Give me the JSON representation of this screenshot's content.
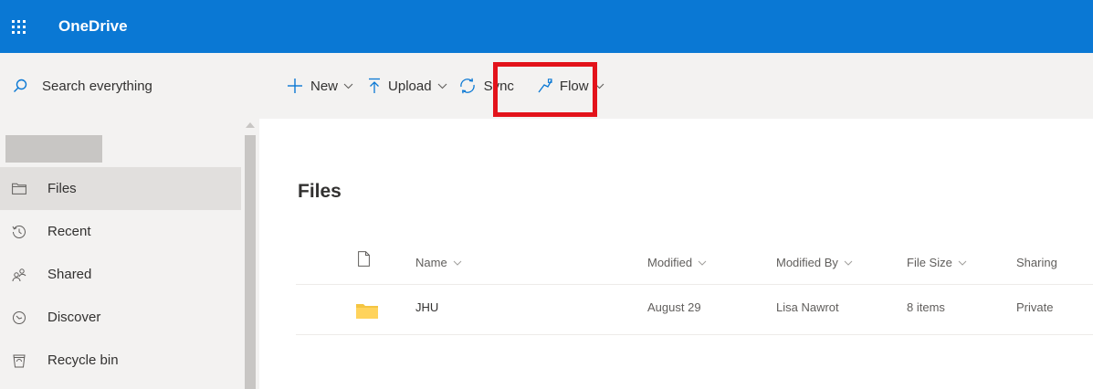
{
  "app": {
    "title": "OneDrive"
  },
  "search": {
    "placeholder": "Search everything",
    "icon": "search-icon"
  },
  "toolbar": {
    "new_label": "New",
    "upload_label": "Upload",
    "sync_label": "Sync",
    "flow_label": "Flow"
  },
  "sidebar": {
    "items": [
      {
        "label": "Files",
        "icon": "folder-icon",
        "active": true
      },
      {
        "label": "Recent",
        "icon": "clock-icon",
        "active": false
      },
      {
        "label": "Shared",
        "icon": "people-icon",
        "active": false
      },
      {
        "label": "Discover",
        "icon": "compass-icon",
        "active": false
      },
      {
        "label": "Recycle bin",
        "icon": "trash-icon",
        "active": false
      }
    ]
  },
  "main": {
    "title": "Files",
    "columns": {
      "name": "Name",
      "modified": "Modified",
      "modified_by": "Modified By",
      "file_size": "File Size",
      "sharing": "Sharing"
    },
    "rows": [
      {
        "name": "JHU",
        "modified": "August 29",
        "modified_by": "Lisa Nawrot",
        "file_size": "8 items",
        "sharing": "Private"
      }
    ]
  },
  "colors": {
    "brand": "#0a78d4",
    "highlight": "#e3131b",
    "folder": "#f4c542"
  }
}
